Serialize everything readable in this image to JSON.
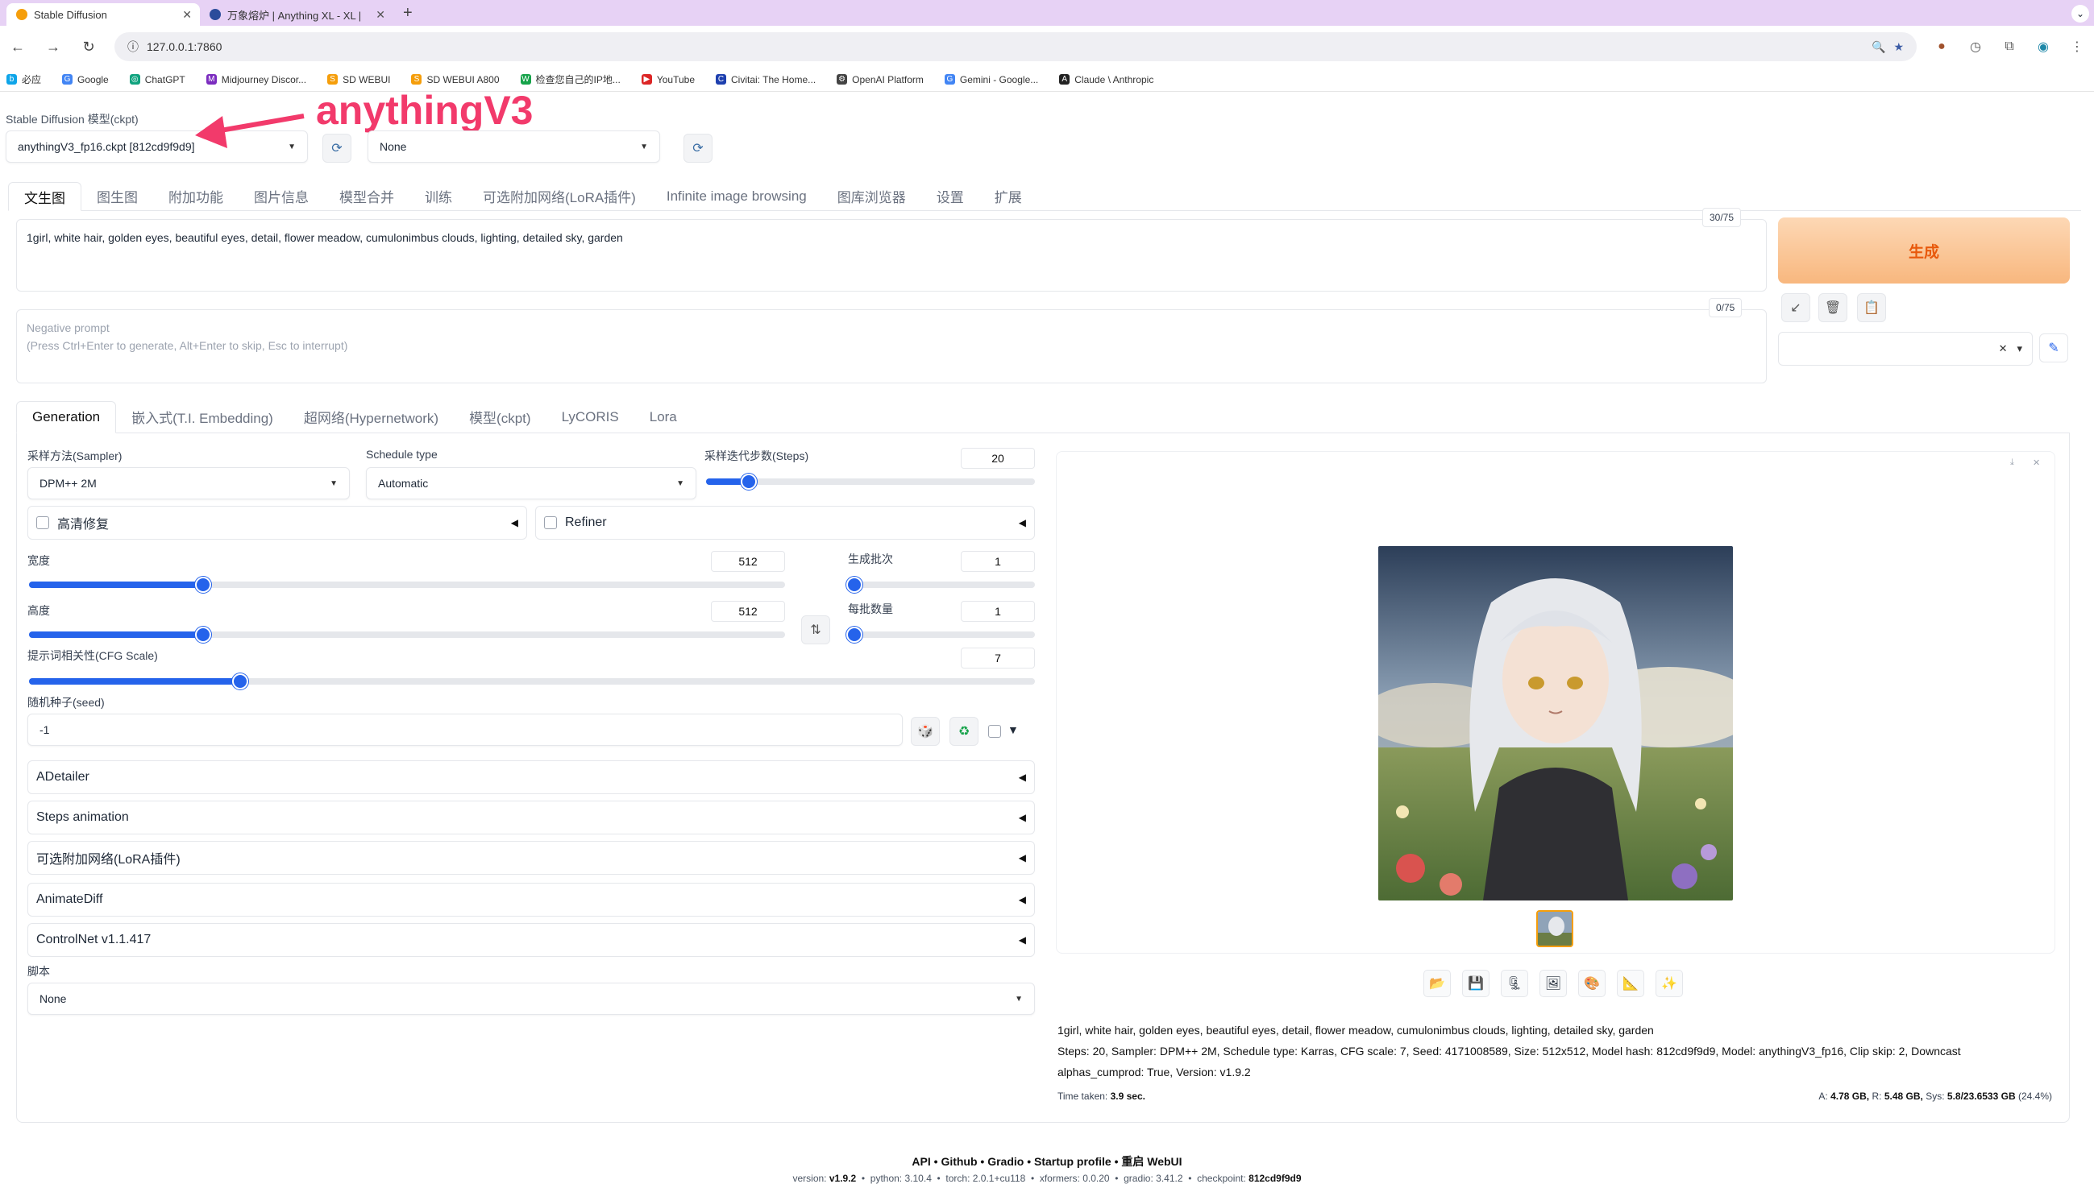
{
  "browser": {
    "tabs": [
      {
        "title": "Stable Diffusion",
        "active": true
      },
      {
        "title": "万象熔炉 | Anything XL - XL |",
        "active": false
      }
    ],
    "url": "127.0.0.1:7860",
    "bookmarks": [
      "必应",
      "Google",
      "ChatGPT",
      "Midjourney Discor...",
      "SD WEBUI",
      "SD WEBUI A800",
      "检查您自己的IP地...",
      "YouTube",
      "Civitai: The Home...",
      "OpenAI Platform",
      "Gemini - Google...",
      "Claude \\ Anthropic"
    ]
  },
  "checkpoint": {
    "label": "Stable Diffusion 模型(ckpt)",
    "value": "anythingV3_fp16.ckpt [812cd9f9d9]",
    "vae_value": "None",
    "annotation": "anythingV3"
  },
  "main_tabs": [
    "文生图",
    "图生图",
    "附加功能",
    "图片信息",
    "模型合并",
    "训练",
    "可选附加网络(LoRA插件)",
    "Infinite image browsing",
    "图库浏览器",
    "设置",
    "扩展"
  ],
  "prompt": {
    "positive": "1girl, white hair, golden eyes, beautiful eyes, detail, flower meadow, cumulonimbus clouds, lighting, detailed sky, garden",
    "positive_count": "30/75",
    "negative_placeholder": "Negative prompt",
    "negative_hint": "(Press Ctrl+Enter to generate, Alt+Enter to skip, Esc to interrupt)",
    "negative_count": "0/75"
  },
  "generate_label": "生成",
  "sub_tabs": [
    "Generation",
    "嵌入式(T.I. Embedding)",
    "超网络(Hypernetwork)",
    "模型(ckpt)",
    "LyCORIS",
    "Lora"
  ],
  "params": {
    "sampler_label": "采样方法(Sampler)",
    "sampler_value": "DPM++ 2M",
    "schedule_label": "Schedule type",
    "schedule_value": "Automatic",
    "steps_label": "采样迭代步数(Steps)",
    "steps_value": "20",
    "steps_frac": 0.13,
    "hires_label": "高清修复",
    "refiner_label": "Refiner",
    "width_label": "宽度",
    "width_value": "512",
    "width_frac": 0.23,
    "height_label": "高度",
    "height_value": "512",
    "height_frac": 0.23,
    "batch_count_label": "生成批次",
    "batch_count_value": "1",
    "batch_count_frac": 0.0,
    "batch_size_label": "每批数量",
    "batch_size_value": "1",
    "batch_size_frac": 0.0,
    "cfg_label": "提示词相关性(CFG Scale)",
    "cfg_value": "7",
    "cfg_frac": 0.21,
    "seed_label": "随机种子(seed)",
    "seed_value": "-1"
  },
  "accordions": [
    "ADetailer",
    "Steps animation",
    "可选附加网络(LoRA插件)",
    "AnimateDiff",
    "ControlNet v1.1.417"
  ],
  "script": {
    "label": "脚本",
    "value": "None"
  },
  "output": {
    "info_line1": "1girl, white hair, golden eyes, beautiful eyes, detail, flower meadow, cumulonimbus clouds, lighting, detailed sky, garden",
    "info_line2": "Steps: 20, Sampler: DPM++ 2M, Schedule type: Karras, CFG scale: 7, Seed: 4171008589, Size: 512x512, Model hash: 812cd9f9d9, Model: anythingV3_fp16, Clip skip: 2, Downcast",
    "info_line3": "alphas_cumprod: True, Version: v1.9.2",
    "time_label": "Time taken:",
    "time_value": "3.9 sec.",
    "mem_a_label": "A:",
    "mem_a": "4.78 GB,",
    "mem_r_label": "R:",
    "mem_r": "5.48 GB,",
    "mem_sys_label": "Sys:",
    "mem_sys": "5.8/23.6533 GB",
    "mem_pct": "(24.4%)"
  },
  "footer": {
    "links": "API  •  Github  •  Gradio  •  Startup profile  •  重启 WebUI",
    "v_label": "version:",
    "v": "v1.9.2",
    "py_label": "python:",
    "py": "3.10.4",
    "torch_label": "torch:",
    "torch": "2.0.1+cu118",
    "xf_label": "xformers:",
    "xf": "0.0.20",
    "gr_label": "gradio:",
    "gr": "3.41.2",
    "ck_label": "checkpoint:",
    "ck": "812cd9f9d9"
  }
}
